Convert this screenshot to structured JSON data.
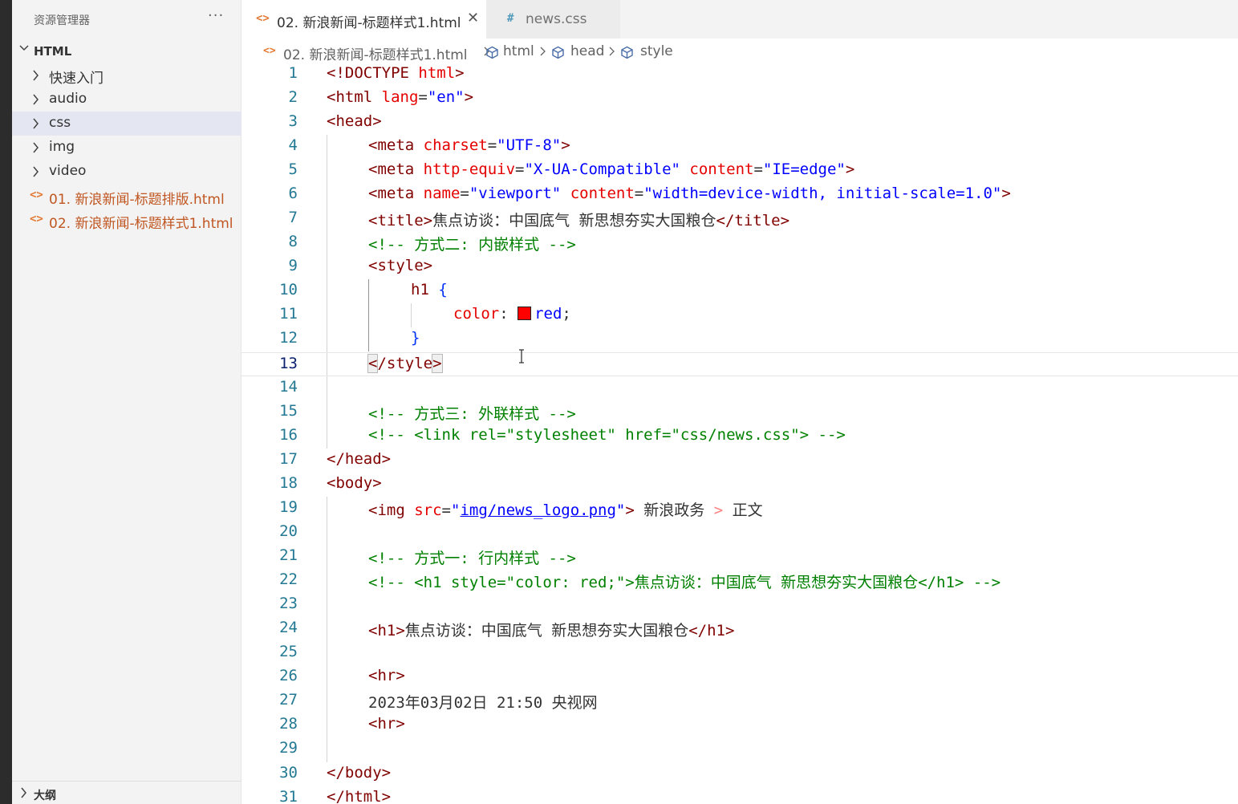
{
  "explorer": {
    "title": "资源管理器",
    "more_label": "···",
    "root_folder": "HTML",
    "items": [
      {
        "label": "快速入门",
        "type": "folder"
      },
      {
        "label": "audio",
        "type": "folder"
      },
      {
        "label": "css",
        "type": "folder",
        "selected": true
      },
      {
        "label": "img",
        "type": "folder"
      },
      {
        "label": "video",
        "type": "folder"
      },
      {
        "label": "01. 新浪新闻-标题排版.html",
        "type": "file"
      },
      {
        "label": "02. 新浪新闻-标题样式1.html",
        "type": "file"
      }
    ],
    "file_icon": "<>",
    "outline_label": "大纲"
  },
  "tabs": [
    {
      "label": "02. 新浪新闻-标题样式1.html",
      "icon": "<>",
      "active": true,
      "close": "✕"
    },
    {
      "label": "news.css",
      "icon": "#",
      "active": false
    }
  ],
  "breadcrumb": {
    "file": "02. 新浪新闻-标题样式1.html",
    "items": [
      "html",
      "head",
      "style"
    ]
  },
  "editor": {
    "current_line": 13,
    "line_numbers": [
      "1",
      "2",
      "3",
      "4",
      "5",
      "6",
      "7",
      "8",
      "9",
      "10",
      "11",
      "12",
      "13",
      "14",
      "15",
      "16",
      "17",
      "18",
      "19",
      "20",
      "21",
      "22",
      "23",
      "24",
      "25",
      "26",
      "27",
      "28",
      "29",
      "30",
      "31"
    ],
    "code": {
      "l1": {
        "a": "<!DOCTYPE ",
        "b": "html",
        "c": ">"
      },
      "l2": {
        "a": "<html ",
        "b": "lang",
        "c": "=",
        "d": "\"en\"",
        "e": ">"
      },
      "l3": {
        "a": "<head>"
      },
      "l4": {
        "a": "<meta ",
        "b": "charset",
        "c": "=",
        "d": "\"UTF-8\"",
        "e": ">"
      },
      "l5": {
        "a": "<meta ",
        "b": "http-equiv",
        "c": "=",
        "d": "\"X-UA-Compatible\"",
        "e": " content",
        "f": "=",
        "g": "\"IE=edge\"",
        "h": ">"
      },
      "l6": {
        "a": "<meta ",
        "b": "name",
        "c": "=",
        "d": "\"viewport\"",
        "e": " content",
        "f": "=",
        "g": "\"width=device-width, initial-scale=1.0\"",
        "h": ">"
      },
      "l7": {
        "a": "<title>",
        "b": "焦点访谈：中国底气 新思想夯实大国粮仓",
        "c": "</title>"
      },
      "l8": {
        "a": "<!-- 方式二: 内嵌样式 -->"
      },
      "l9": {
        "a": "<style>"
      },
      "l10": {
        "a": "h1",
        "b": " {"
      },
      "l11": {
        "a": "color",
        "b": ": ",
        "c": "red",
        "d": ";"
      },
      "l12": {
        "a": "}"
      },
      "l13": {
        "a": "<",
        "b": "/style",
        "c": ">"
      },
      "l15": {
        "a": "<!-- 方式三: 外联样式 -->"
      },
      "l16": {
        "a": "<!-- <link rel=\"stylesheet\" href=\"css/news.css\"> -->"
      },
      "l17": {
        "a": "</head>"
      },
      "l18": {
        "a": "<body>"
      },
      "l19": {
        "a": "<img ",
        "b": "src",
        "c": "=",
        "d": "\"",
        "e": "img/news_logo.png",
        "f": "\"",
        "g": ">",
        "h": " 新浪政务 ",
        "i": ">",
        "j": " 正文"
      },
      "l21": {
        "a": "<!-- 方式一: 行内样式 -->"
      },
      "l22": {
        "a": "<!-- <h1 style=\"color: red;\">焦点访谈：中国底气 新思想夯实大国粮仓</h1> -->"
      },
      "l24": {
        "a": "<h1>",
        "b": "焦点访谈：中国底气 新思想夯实大国粮仓",
        "c": "</h1>"
      },
      "l26": {
        "a": "<hr>"
      },
      "l27": {
        "a": "2023年03月02日 21:50 央视网"
      },
      "l28": {
        "a": "<hr>"
      },
      "l30": {
        "a": "</body>"
      },
      "l31": {
        "a": "</html>"
      }
    }
  },
  "colors": {
    "tag": "#800000",
    "attribute": "#e50000",
    "value": "#0000ff",
    "comment": "#008000",
    "line_number": "#237893",
    "swatch_red": "#ff0000"
  }
}
